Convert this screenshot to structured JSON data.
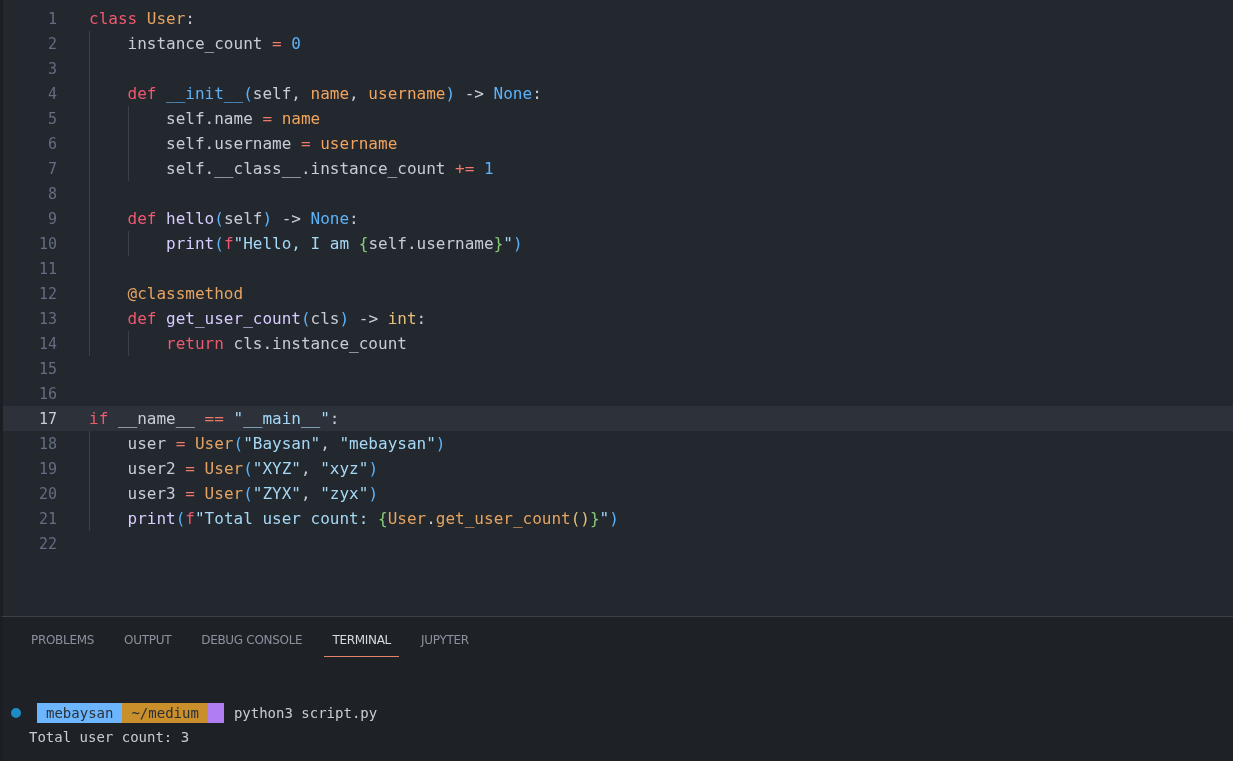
{
  "editor": {
    "lines": [
      {
        "number": "1",
        "current": false,
        "tokens": [
          {
            "t": "class ",
            "kind": "kw"
          },
          {
            "t": "User",
            "kind": "cls"
          },
          {
            "t": ":",
            "kind": "plain"
          }
        ]
      },
      {
        "number": "2",
        "current": false,
        "tokens": [
          {
            "t": "    instance_count",
            "kind": "plain"
          },
          {
            "t": " = ",
            "kind": "op"
          },
          {
            "t": "0",
            "kind": "num"
          }
        ]
      },
      {
        "number": "3",
        "current": false
      },
      {
        "number": "4",
        "current": false,
        "tokens": [
          {
            "t": "    def ",
            "kind": "kw"
          },
          {
            "t": "__init__",
            "kind": "magic"
          },
          {
            "t": "(",
            "kind": "br1"
          },
          {
            "t": "self, ",
            "kind": "plain"
          },
          {
            "t": "name",
            "kind": "param"
          },
          {
            "t": ", ",
            "kind": "plain"
          },
          {
            "t": "username",
            "kind": "param"
          },
          {
            "t": ")",
            "kind": "br1"
          },
          {
            "t": " -> ",
            "kind": "plain"
          },
          {
            "t": "None",
            "kind": "type"
          },
          {
            "t": ":",
            "kind": "plain"
          }
        ]
      },
      {
        "number": "5",
        "current": false,
        "tokens": [
          {
            "t": "        self.name",
            "kind": "plain"
          },
          {
            "t": " = ",
            "kind": "op"
          },
          {
            "t": "name",
            "kind": "param"
          }
        ]
      },
      {
        "number": "6",
        "current": false,
        "tokens": [
          {
            "t": "        self.username",
            "kind": "plain"
          },
          {
            "t": " = ",
            "kind": "op"
          },
          {
            "t": "username",
            "kind": "param"
          }
        ]
      },
      {
        "number": "7",
        "current": false,
        "tokens": [
          {
            "t": "        self.__class__.instance_count",
            "kind": "plain"
          },
          {
            "t": " += ",
            "kind": "op"
          },
          {
            "t": "1",
            "kind": "num"
          }
        ]
      },
      {
        "number": "8",
        "current": false
      },
      {
        "number": "9",
        "current": false,
        "tokens": [
          {
            "t": "    def ",
            "kind": "kw"
          },
          {
            "t": "hello",
            "kind": "fn"
          },
          {
            "t": "(",
            "kind": "br1"
          },
          {
            "t": "self",
            "kind": "plain"
          },
          {
            "t": ")",
            "kind": "br1"
          },
          {
            "t": " -> ",
            "kind": "plain"
          },
          {
            "t": "None",
            "kind": "type"
          },
          {
            "t": ":",
            "kind": "plain"
          }
        ]
      },
      {
        "number": "10",
        "current": false,
        "tokens": [
          {
            "t": "        print",
            "kind": "fn"
          },
          {
            "t": "(",
            "kind": "br1"
          },
          {
            "t": "f",
            "kind": "kw"
          },
          {
            "t": "\"Hello, I am ",
            "kind": "str"
          },
          {
            "t": "{",
            "kind": "br2"
          },
          {
            "t": "self.username",
            "kind": "plain"
          },
          {
            "t": "}",
            "kind": "br2"
          },
          {
            "t": "\"",
            "kind": "str"
          },
          {
            "t": ")",
            "kind": "br1"
          }
        ]
      },
      {
        "number": "11",
        "current": false
      },
      {
        "number": "12",
        "current": false,
        "tokens": [
          {
            "t": "    @classmethod",
            "kind": "deco"
          }
        ]
      },
      {
        "number": "13",
        "current": false,
        "tokens": [
          {
            "t": "    def ",
            "kind": "kw"
          },
          {
            "t": "get_user_count",
            "kind": "fn"
          },
          {
            "t": "(",
            "kind": "br1"
          },
          {
            "t": "cls",
            "kind": "plain"
          },
          {
            "t": ")",
            "kind": "br1"
          },
          {
            "t": " -> ",
            "kind": "plain"
          },
          {
            "t": "int",
            "kind": "builtin"
          },
          {
            "t": ":",
            "kind": "plain"
          }
        ]
      },
      {
        "number": "14",
        "current": false,
        "tokens": [
          {
            "t": "        return ",
            "kind": "kw"
          },
          {
            "t": "cls.instance_count",
            "kind": "plain"
          }
        ]
      },
      {
        "number": "15",
        "current": false
      },
      {
        "number": "16",
        "current": false
      },
      {
        "number": "17",
        "current": true,
        "tokens": [
          {
            "t": "if ",
            "kind": "kw"
          },
          {
            "t": "__name__",
            "kind": "plain"
          },
          {
            "t": " == ",
            "kind": "op"
          },
          {
            "t": "\"__main__\"",
            "kind": "str"
          },
          {
            "t": ":",
            "kind": "plain"
          }
        ]
      },
      {
        "number": "18",
        "current": false,
        "tokens": [
          {
            "t": "    user",
            "kind": "plain"
          },
          {
            "t": " = ",
            "kind": "op"
          },
          {
            "t": "User",
            "kind": "cls"
          },
          {
            "t": "(",
            "kind": "br1"
          },
          {
            "t": "\"Baysan\"",
            "kind": "str"
          },
          {
            "t": ", ",
            "kind": "plain"
          },
          {
            "t": "\"mebaysan\"",
            "kind": "str"
          },
          {
            "t": ")",
            "kind": "br1"
          }
        ]
      },
      {
        "number": "19",
        "current": false,
        "tokens": [
          {
            "t": "    user2",
            "kind": "plain"
          },
          {
            "t": " = ",
            "kind": "op"
          },
          {
            "t": "User",
            "kind": "cls"
          },
          {
            "t": "(",
            "kind": "br1"
          },
          {
            "t": "\"XYZ\"",
            "kind": "str"
          },
          {
            "t": ", ",
            "kind": "plain"
          },
          {
            "t": "\"xyz\"",
            "kind": "str"
          },
          {
            "t": ")",
            "kind": "br1"
          }
        ]
      },
      {
        "number": "20",
        "current": false,
        "tokens": [
          {
            "t": "    user3",
            "kind": "plain"
          },
          {
            "t": " = ",
            "kind": "op"
          },
          {
            "t": "User",
            "kind": "cls"
          },
          {
            "t": "(",
            "kind": "br1"
          },
          {
            "t": "\"ZYX\"",
            "kind": "str"
          },
          {
            "t": ", ",
            "kind": "plain"
          },
          {
            "t": "\"zyx\"",
            "kind": "str"
          },
          {
            "t": ")",
            "kind": "br1"
          }
        ]
      },
      {
        "number": "21",
        "current": false,
        "tokens": [
          {
            "t": "    print",
            "kind": "fn"
          },
          {
            "t": "(",
            "kind": "br1"
          },
          {
            "t": "f",
            "kind": "kw"
          },
          {
            "t": "\"Total user count: ",
            "kind": "str"
          },
          {
            "t": "{",
            "kind": "br2"
          },
          {
            "t": "User",
            "kind": "cls"
          },
          {
            "t": ".",
            "kind": "plain"
          },
          {
            "t": "get_user_count",
            "kind": "cls"
          },
          {
            "t": "()",
            "kind": "br3"
          },
          {
            "t": "}",
            "kind": "br2"
          },
          {
            "t": "\"",
            "kind": "str"
          },
          {
            "t": ")",
            "kind": "br1"
          }
        ]
      },
      {
        "number": "22",
        "current": false
      }
    ]
  },
  "panel": {
    "tabs": [
      {
        "label": "PROBLEMS",
        "selected": false
      },
      {
        "label": "OUTPUT",
        "selected": false
      },
      {
        "label": "DEBUG CONSOLE",
        "selected": false
      },
      {
        "label": "TERMINAL",
        "selected": true
      },
      {
        "label": "JUPYTER",
        "selected": false
      }
    ],
    "terminal": [
      {
        "kind": "prompt",
        "segments": [
          {
            "text": "mebaysan",
            "color": "#6cb6ff"
          },
          {
            "text": "~/medium",
            "color": "#c98f2a"
          },
          {
            "color": "#b07ef0"
          }
        ],
        "command": "python3 script.py"
      },
      {
        "kind": "output",
        "text": "Total user count: 3"
      }
    ]
  }
}
